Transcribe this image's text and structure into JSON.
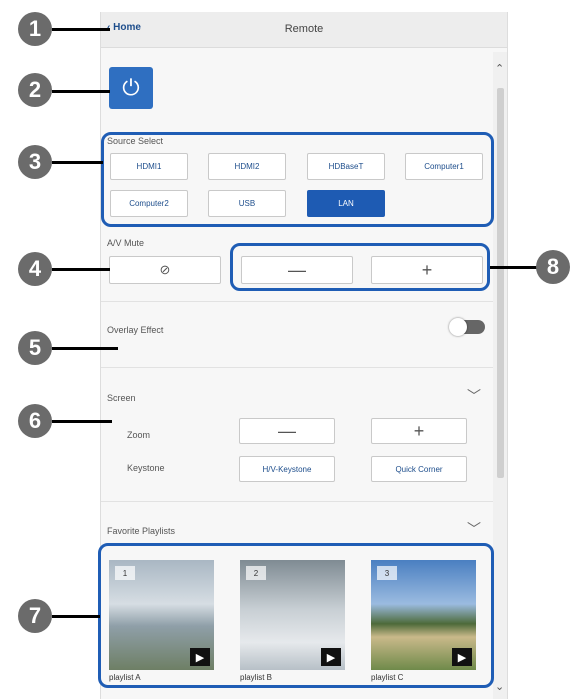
{
  "header": {
    "home_label": "Home",
    "title": "Remote"
  },
  "source_select": {
    "label": "Source Select",
    "sources": [
      "HDMI1",
      "HDMI2",
      "HDBaseT",
      "Computer1",
      "Computer2",
      "USB",
      "LAN"
    ],
    "active": "LAN"
  },
  "av_mute": {
    "label": "A/V Mute"
  },
  "volume": {
    "minus": "—",
    "plus": "+"
  },
  "overlay": {
    "label": "Overlay Effect",
    "enabled": false
  },
  "screen": {
    "label": "Screen",
    "zoom_label": "Zoom",
    "zoom_minus": "—",
    "zoom_plus": "+",
    "keystone_label": "Keystone",
    "hv_keystone": "H/V-Keystone",
    "quick_corner": "Quick Corner"
  },
  "favorites": {
    "label": "Favorite Playlists",
    "playlists": [
      {
        "number": "1",
        "name": "playlist A"
      },
      {
        "number": "2",
        "name": "playlist B"
      },
      {
        "number": "3",
        "name": "playlist C"
      }
    ]
  },
  "callouts": [
    "1",
    "2",
    "3",
    "4",
    "5",
    "6",
    "7",
    "8"
  ],
  "colors": {
    "accent": "#1f5db5",
    "active_button": "#1e5bb3",
    "callout": "#6b6b6b"
  }
}
